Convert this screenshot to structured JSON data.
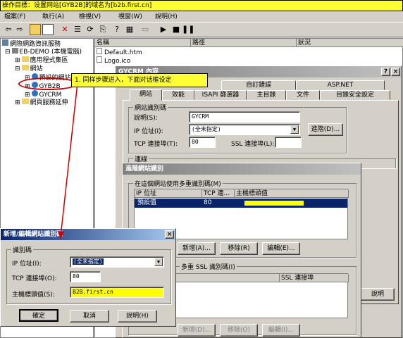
{
  "banner": {
    "text": "操作目標：设置网站[GYB2B]的域名为[b2b.first.cn]"
  },
  "menu": [
    "檔案(F)",
    "執行(A)",
    "檢視(V)",
    "視窗(W)",
    "說明(H)"
  ],
  "tree": [
    {
      "label": "網際網路資訊服務"
    },
    {
      "label": "EB-DEMO (本機電腦)"
    },
    {
      "label": "應用程式集區"
    },
    {
      "label": "網站"
    },
    {
      "label": "預設的網站"
    },
    {
      "label": "GYB2B"
    },
    {
      "label": "GYCRM"
    },
    {
      "label": "網頁服務延伸"
    }
  ],
  "list": {
    "columns": [
      "名稱",
      "路徑",
      "狀況"
    ],
    "rows": [
      {
        "name": "Default.htm"
      },
      {
        "name": "Logo.ico"
      }
    ]
  },
  "callout": {
    "text": "1.  同样步骤进入，下面对话框设定"
  },
  "props_dialog": {
    "title": "GYCRM 內容",
    "tabs_back": [
      "自訂錯誤",
      "ASP.NET"
    ],
    "tabs_front": [
      "網站",
      "效能",
      "ISAPI 篩選器",
      "主目錄",
      "文件",
      "目錄安全設定"
    ],
    "group_identity": "網站識別碼",
    "desc_label": "說明(S):",
    "desc_value": "GYCRM",
    "ip_label": "IP 位址(I):",
    "ip_value": "(全未指定)",
    "advanced_button": "進階(D)...",
    "tcp_label": "TCP 連接埠(T):",
    "tcp_value": "80",
    "ssl_label": "SSL 連接埠(L):",
    "ssl_value": "",
    "group_connection": "連線",
    "help_button": "說明"
  },
  "advanced_dialog": {
    "title": "進階網站識別",
    "group_multi": "在這個網站使用多重識別碼(M)",
    "columns": [
      "IP 位址",
      "TCP 連...",
      "主機標頭值"
    ],
    "rows": [
      {
        "ip": "預設值",
        "port": "80",
        "host": ""
      }
    ],
    "add": "新增(A)...",
    "remove": "移除(R)",
    "edit": "編輯(E)...",
    "group_ssl": "多重 SSL 識別碼(I)",
    "ssl_column": "SSL 連接埠",
    "add_ssl": "新增(D)...",
    "remove_ssl": "移除(O)",
    "edit_ssl": "編輯(I)..."
  },
  "edit_dialog": {
    "title": "新增/編輯網站識別碼",
    "group": "識別碼",
    "ip_label": "IP 位址(I):",
    "ip_value": "(全未指定)",
    "tcp_label": "TCP 連接埠(O):",
    "tcp_value": "80",
    "host_label": "主機標頭值(S):",
    "host_value": "B2B.first.cn",
    "ok": "確定",
    "cancel": "取消",
    "help": "說明(H)"
  },
  "colors": {
    "highlight": "#ffff00",
    "accent": "#0a246a",
    "annotation": "#cc0000"
  }
}
